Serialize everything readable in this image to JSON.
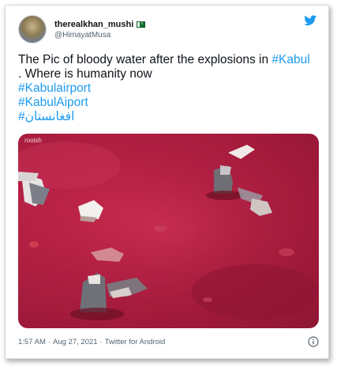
{
  "tweet": {
    "display_name": "therealkhan_mushi",
    "handle": "@HimayatMusa",
    "text_lines": [
      {
        "plain": "The Pic of bloody water after the explosions in ",
        "tag": "#Kabul"
      },
      {
        "plain": ". Where is humanity now",
        "tag": ""
      },
      {
        "plain": "",
        "tag": "#Kabulairport"
      },
      {
        "plain": "",
        "tag": "#KabulAiport"
      },
      {
        "plain": "",
        "tag": "#افغانستان"
      }
    ],
    "media_watermark": "rooish",
    "time": "1:57 AM",
    "separator": "·",
    "date": "Aug 27, 2021",
    "source": "Twitter for Android"
  },
  "colors": {
    "link": "#1d9bf0",
    "twitter_brand": "#1d9bf0",
    "water": "#b01f42"
  },
  "icons": {
    "brand": "twitter-bird-icon",
    "flag": "pakistan-flag-icon",
    "info": "info-icon"
  }
}
